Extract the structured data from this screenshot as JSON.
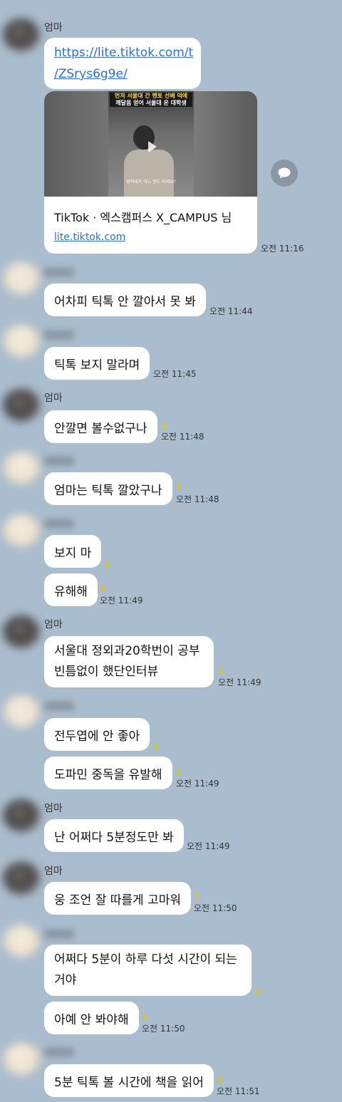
{
  "sender_mom": "엄마",
  "link_message": {
    "url_line1": "https://lite.tiktok.com/t",
    "url_line2": "/ZSrys6g9e/",
    "card_title": "TikTok · 엑스캠퍼스 X_CAMPUS 님",
    "card_domain": "lite.tiktok.com",
    "thumb_caption_1": "먼저 서울대 간 멘토 선배 덕에",
    "thumb_caption_2": "깨달음 얻어 서울대 온 대학생",
    "thumb_subtitle": "성적대가 어느 정도 되세요?",
    "time": "오전 11:16"
  },
  "messages": [
    {
      "text": "어차피 틱톡 안 깔아서 못 봐",
      "time": "오전 11:44",
      "unread": ""
    },
    {
      "text": "틱톡 보지 말라며",
      "time": "오전 11:45",
      "unread": ""
    },
    {
      "text": "안깔면 볼수없구나",
      "time": "오전 11:48",
      "unread": "1"
    },
    {
      "text": "엄마는 틱톡 깔았구나",
      "time": "오전 11:48",
      "unread": "1"
    },
    {
      "text": "보지 마",
      "time": "",
      "unread": "1"
    },
    {
      "text": "유해해",
      "time": "오전 11:49",
      "unread": "1"
    },
    {
      "text_line1": "서울대 정외과20학번이 공부",
      "text_line2": "빈틈없이 했단인터뷰",
      "time": "오전 11:49",
      "unread": "1"
    },
    {
      "text": "전두엽에 안 좋아",
      "time": "",
      "unread": "1"
    },
    {
      "text": "도파민 중독을 유발해",
      "time": "오전 11:49",
      "unread": "1"
    },
    {
      "text": "난 어쩌다 5분정도만 봐",
      "time": "오전 11:49",
      "unread": ""
    },
    {
      "text": "웅 조언 잘 따를게 고마워",
      "time": "오전 11:50",
      "unread": "1"
    },
    {
      "text_line1": "어쩌다 5분이 하루 다섯 시간이 되는",
      "text_line2": "거야",
      "time": "",
      "unread": "1"
    },
    {
      "text": "아예 안 봐야해",
      "time": "오전 11:50",
      "unread": "1"
    },
    {
      "text": "5분 틱톡 볼 시간에 책을 읽어",
      "time": "오전 11:51",
      "unread": "2"
    }
  ],
  "icons": {
    "share": "speech-bubble-icon"
  }
}
